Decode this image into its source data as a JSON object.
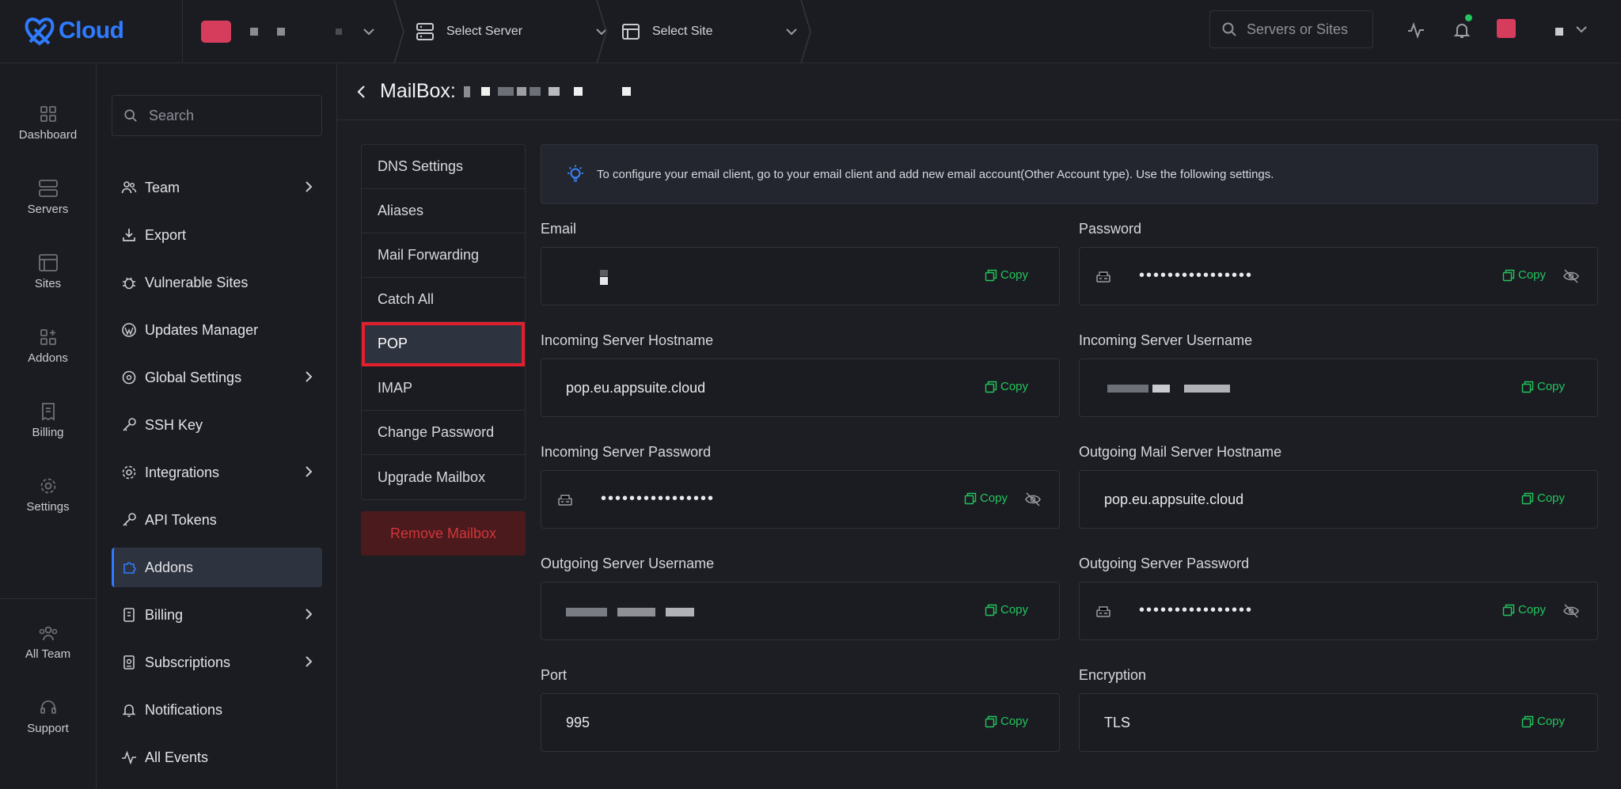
{
  "brand": {
    "logo_text": "Cloud",
    "accent": "#2f7bff"
  },
  "topbar": {
    "select_server": "Select Server",
    "select_site": "Select Site",
    "search_placeholder": "Servers or Sites",
    "icons": [
      "activity-icon",
      "bell-icon",
      "chevron-down-icon"
    ]
  },
  "rail": {
    "items": [
      {
        "label": "Dashboard",
        "icon": "dashboard-icon"
      },
      {
        "label": "Servers",
        "icon": "server-icon"
      },
      {
        "label": "Sites",
        "icon": "browser-icon"
      },
      {
        "label": "Addons",
        "icon": "addons-icon"
      },
      {
        "label": "Billing",
        "icon": "receipt-icon"
      },
      {
        "label": "Settings",
        "icon": "gear-icon"
      }
    ],
    "bottom": [
      {
        "label": "All Team",
        "icon": "team-icon"
      },
      {
        "label": "Support",
        "icon": "headset-icon"
      }
    ]
  },
  "subnav": {
    "search_placeholder": "Search",
    "items": [
      {
        "label": "Team",
        "icon": "users-icon",
        "has_children": true
      },
      {
        "label": "Export",
        "icon": "download-icon"
      },
      {
        "label": "Vulnerable Sites",
        "icon": "bug-icon"
      },
      {
        "label": "Updates Manager",
        "icon": "wordpress-icon"
      },
      {
        "label": "Global Settings",
        "icon": "globe-gear-icon",
        "has_children": true
      },
      {
        "label": "SSH Key",
        "icon": "key-icon"
      },
      {
        "label": "Integrations",
        "icon": "gear-icon",
        "has_children": true
      },
      {
        "label": "API Tokens",
        "icon": "key-icon"
      },
      {
        "label": "Addons",
        "icon": "puzzle-icon",
        "active": true
      },
      {
        "label": "Billing",
        "icon": "invoice-icon",
        "has_children": true
      },
      {
        "label": "Subscriptions",
        "icon": "subscription-icon",
        "has_children": true
      },
      {
        "label": "Notifications",
        "icon": "bell-icon"
      },
      {
        "label": "All Events",
        "icon": "activity-icon"
      }
    ]
  },
  "page": {
    "title_prefix": "MailBox:",
    "tabs": [
      "DNS Settings",
      "Aliases",
      "Mail Forwarding",
      "Catch All",
      "POP",
      "IMAP",
      "Change Password",
      "Upgrade Mailbox"
    ],
    "active_tab": "POP",
    "remove_label": "Remove Mailbox",
    "info": "To configure your email client, go to your email client and add new email account(Other Account type). Use the following settings.",
    "copy_label": "Copy",
    "fields": {
      "email": {
        "label": "Email",
        "value": ""
      },
      "password": {
        "label": "Password",
        "value": "••••••••••••••••"
      },
      "in_host": {
        "label": "Incoming Server Hostname",
        "value": "pop.eu.appsuite.cloud"
      },
      "in_user": {
        "label": "Incoming Server Username",
        "value": ""
      },
      "in_pass": {
        "label": "Incoming Server Password",
        "value": "••••••••••••••••"
      },
      "out_host": {
        "label": "Outgoing Mail Server Hostname",
        "value": "pop.eu.appsuite.cloud"
      },
      "out_user": {
        "label": "Outgoing Server Username",
        "value": ""
      },
      "out_pass": {
        "label": "Outgoing Server Password",
        "value": "••••••••••••••••"
      },
      "port": {
        "label": "Port",
        "value": "995"
      },
      "encryption": {
        "label": "Encryption",
        "value": "TLS"
      }
    }
  },
  "colors": {
    "copy_green": "#22c55e",
    "danger_red": "#d2363c",
    "notif_dot": "#22c55e"
  }
}
